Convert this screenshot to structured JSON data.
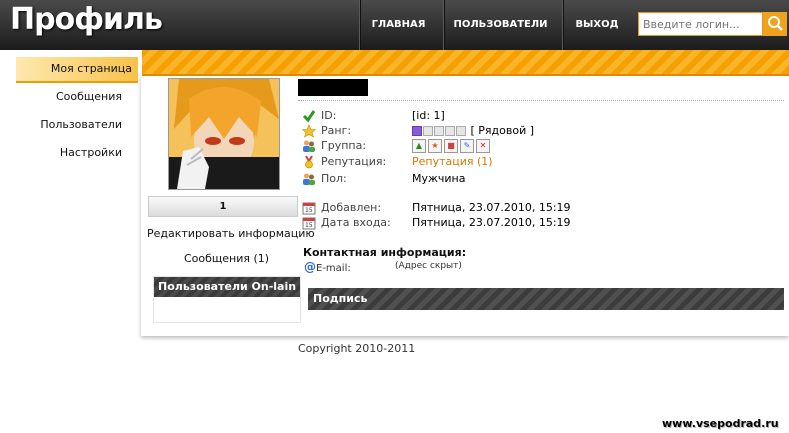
{
  "header": {
    "logo": "Профиль",
    "nav": [
      "ГЛАВНАЯ",
      "ПОЛЬЗОВАТЕЛИ",
      "ВЫХОД"
    ],
    "search_placeholder": "Введите логин..."
  },
  "sidebar": {
    "items": [
      {
        "label": "Моя страница",
        "active": true
      },
      {
        "label": "Сообщения"
      },
      {
        "label": "Пользователи"
      },
      {
        "label": "Настройки"
      }
    ]
  },
  "profile": {
    "rating": "1",
    "edit_label": "Редактировать информацию",
    "messages_label": "Сообщения",
    "messages_count": "(1)",
    "online_title": "Пользователи On-lain",
    "fields": {
      "id_label": "ID:",
      "id_value": "[id: 1]",
      "rank_label": "Ранг:",
      "rank_value": "[ Рядовой ]",
      "group_label": "Группа:",
      "rep_label": "Репутация:",
      "rep_value": "Репутация (1)",
      "gender_label": "Пол:",
      "gender_value": "Мужчина",
      "added_label": "Добавлен:",
      "added_value": "Пятница, 23.07.2010, 15:19",
      "login_label": "Дата входа:",
      "login_value": "Пятница, 23.07.2010, 15:19"
    },
    "contact_title": "Контактная информация:",
    "email_label": "E-mail:",
    "email_value": "(Адрес скрыт)",
    "signature_title": "Подпись"
  },
  "footer": {
    "copyright": "Copyright 2010-2011",
    "watermark": "www.vsepodrad.ru"
  },
  "colors": {
    "accent": "#f6a000",
    "header": "#2a2a2a",
    "rep": "#d47a00"
  }
}
